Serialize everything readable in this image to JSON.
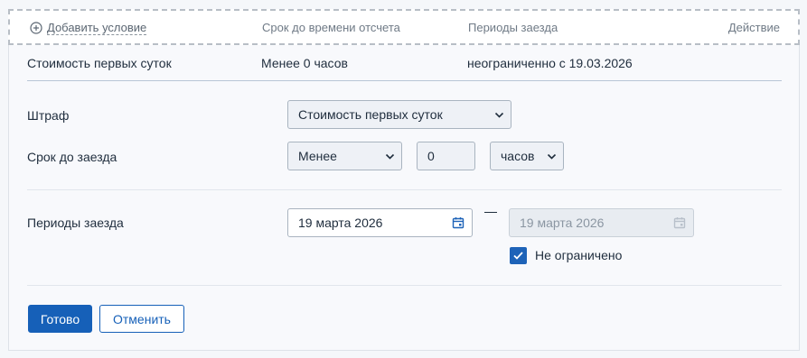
{
  "header": {
    "add_condition": "Добавить условие",
    "col_term": "Срок до времени отсчета",
    "col_periods": "Периоды заезда",
    "col_action": "Действие"
  },
  "summary": {
    "name": "Стоимость первых суток",
    "term": "Менее 0 часов",
    "period": "неограниченно с 19.03.2026"
  },
  "form": {
    "penalty_label": "Штраф",
    "penalty_value": "Стоимость первых суток",
    "term_label": "Срок до заезда",
    "term_operator": "Менее",
    "term_amount": "0",
    "term_unit": "часов",
    "periods_label": "Периоды заезда",
    "date_from": "19 марта 2026",
    "date_to": "19 марта 2026",
    "unlimited_label": "Не ограничено",
    "unlimited_checked": true
  },
  "buttons": {
    "done": "Готово",
    "cancel": "Отменить"
  },
  "colors": {
    "accent": "#1660b8",
    "checkbox": "#1e63b8"
  }
}
